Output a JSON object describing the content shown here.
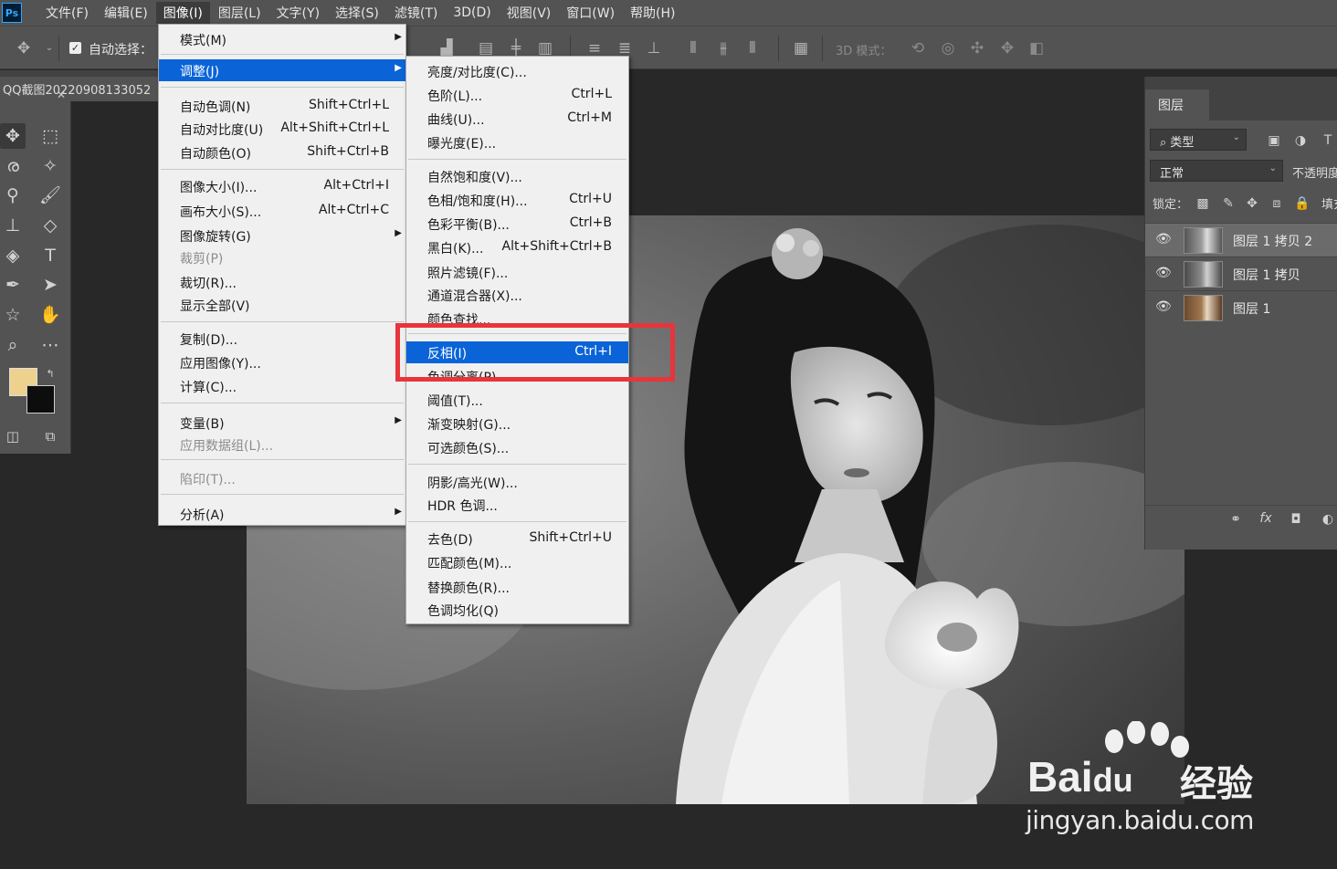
{
  "app": {
    "logo": "Ps"
  },
  "menubar": [
    {
      "label": "文件(F)"
    },
    {
      "label": "编辑(E)"
    },
    {
      "label": "图像(I)",
      "active": true
    },
    {
      "label": "图层(L)"
    },
    {
      "label": "文字(Y)"
    },
    {
      "label": "选择(S)"
    },
    {
      "label": "滤镜(T)"
    },
    {
      "label": "3D(D)"
    },
    {
      "label": "视图(V)"
    },
    {
      "label": "窗口(W)"
    },
    {
      "label": "帮助(H)"
    }
  ],
  "options_bar": {
    "auto_select_label": "自动选择：",
    "auto_select_checked": true,
    "mode_3d_label": "3D 模式："
  },
  "document": {
    "tab_title": "QQ截图20220908133052"
  },
  "colors": {
    "foreground": "#ecd28c",
    "background": "#0d0d0d",
    "highlight": "#0a64d8",
    "callout": "#e8343b"
  },
  "image_menu": {
    "items": [
      {
        "label": "模式(M)",
        "submenu": true
      },
      {
        "label": "调整(J)",
        "submenu": true,
        "highlighted": true
      },
      {
        "label": "自动色调(N)",
        "shortcut": "Shift+Ctrl+L"
      },
      {
        "label": "自动对比度(U)",
        "shortcut": "Alt+Shift+Ctrl+L"
      },
      {
        "label": "自动颜色(O)",
        "shortcut": "Shift+Ctrl+B"
      },
      {
        "label": "图像大小(I)...",
        "shortcut": "Alt+Ctrl+I"
      },
      {
        "label": "画布大小(S)...",
        "shortcut": "Alt+Ctrl+C"
      },
      {
        "label": "图像旋转(G)",
        "submenu": true
      },
      {
        "label": "裁剪(P)",
        "disabled": true
      },
      {
        "label": "裁切(R)..."
      },
      {
        "label": "显示全部(V)"
      },
      {
        "label": "复制(D)..."
      },
      {
        "label": "应用图像(Y)..."
      },
      {
        "label": "计算(C)..."
      },
      {
        "label": "变量(B)",
        "submenu": true
      },
      {
        "label": "应用数据组(L)...",
        "disabled": true
      },
      {
        "label": "陷印(T)...",
        "disabled": true
      },
      {
        "label": "分析(A)",
        "submenu": true
      }
    ]
  },
  "adjust_menu": {
    "items": [
      {
        "label": "亮度/对比度(C)..."
      },
      {
        "label": "色阶(L)...",
        "shortcut": "Ctrl+L"
      },
      {
        "label": "曲线(U)...",
        "shortcut": "Ctrl+M"
      },
      {
        "label": "曝光度(E)..."
      },
      {
        "label": "自然饱和度(V)..."
      },
      {
        "label": "色相/饱和度(H)...",
        "shortcut": "Ctrl+U"
      },
      {
        "label": "色彩平衡(B)...",
        "shortcut": "Ctrl+B"
      },
      {
        "label": "黑白(K)...",
        "shortcut": "Alt+Shift+Ctrl+B"
      },
      {
        "label": "照片滤镜(F)..."
      },
      {
        "label": "通道混合器(X)..."
      },
      {
        "label": "颜色查找..."
      },
      {
        "label": "反相(I)",
        "shortcut": "Ctrl+I",
        "highlighted": true
      },
      {
        "label": "色调分离(P)..."
      },
      {
        "label": "阈值(T)..."
      },
      {
        "label": "渐变映射(G)..."
      },
      {
        "label": "可选颜色(S)..."
      },
      {
        "label": "阴影/高光(W)..."
      },
      {
        "label": "HDR 色调..."
      },
      {
        "label": "去色(D)",
        "shortcut": "Shift+Ctrl+U"
      },
      {
        "label": "匹配颜色(M)..."
      },
      {
        "label": "替换颜色(R)..."
      },
      {
        "label": "色调均化(Q)"
      }
    ]
  },
  "layers_panel": {
    "tab": "图层",
    "filter_kind": "类型",
    "blend_mode": "正常",
    "opacity_label": "不透明度",
    "lock_label": "锁定：",
    "fill_label": "填充",
    "layers": [
      {
        "name": "图层 1 拷贝 2",
        "selected": true
      },
      {
        "name": "图层 1 拷贝"
      },
      {
        "name": "图层 1"
      }
    ],
    "footer_fx": "fx"
  },
  "watermark": {
    "brand_left": "Bai",
    "brand_mid": "du",
    "brand_right": "经验",
    "url": "jingyan.baidu.com"
  }
}
